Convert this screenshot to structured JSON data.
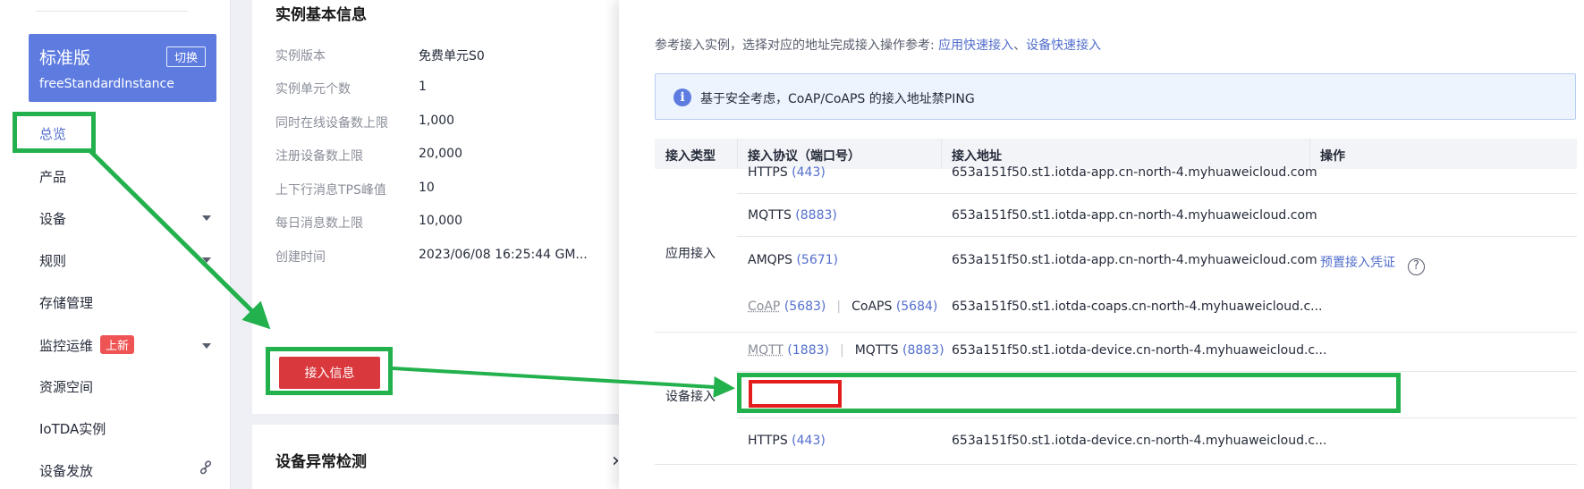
{
  "sidebar": {
    "edition": {
      "title": "标准版",
      "switch_label": "切换",
      "instance": "freeStandardInstance"
    },
    "items": [
      {
        "label": "总览",
        "active": true
      },
      {
        "label": "产品"
      },
      {
        "label": "设备",
        "expandable": true
      },
      {
        "label": "规则",
        "expandable": true
      },
      {
        "label": "存储管理"
      },
      {
        "label": "监控运维",
        "badge": "上新",
        "expandable": true
      },
      {
        "label": "资源空间"
      },
      {
        "label": "IoTDA实例"
      },
      {
        "label": "设备发放",
        "icon": "link-icon"
      }
    ]
  },
  "instance_info": {
    "title": "实例基本信息",
    "rows": [
      {
        "key": "实例版本",
        "value": "免费单元S0"
      },
      {
        "key": "实例单元个数",
        "value": "1"
      },
      {
        "key": "同时在线设备数上限",
        "value": "1,000"
      },
      {
        "key": "注册设备数上限",
        "value": "20,000"
      },
      {
        "key": "上下行消息TPS峰值",
        "value": "10"
      },
      {
        "key": "每日消息数上限",
        "value": "10,000"
      },
      {
        "key": "创建时间",
        "value": "2023/06/08 16:25:44 GM..."
      }
    ],
    "access_button": "接入信息"
  },
  "anomaly_section": {
    "title": "设备异常检测"
  },
  "drawer": {
    "ref_text": "参考接入实例，选择对应的地址完成接入操作参考: ",
    "ref_link_app": "应用快速接入",
    "ref_sep": "、",
    "ref_link_device": "设备快速接入",
    "notice": "基于安全考虑，CoAP/CoAPS 的接入地址禁PING",
    "table": {
      "headers": [
        "接入类型",
        "接入协议（端口号）",
        "接入地址",
        "操作"
      ],
      "groups": [
        {
          "label": "应用接入"
        },
        {
          "label": "设备接入"
        }
      ],
      "rows": [
        {
          "p1": "HTTPS",
          "port1": "(443)",
          "address": "653a151f50.st1.iotda-app.cn-north-4.myhuaweicloud.com"
        },
        {
          "p1": "MQTTS",
          "port1": "(8883)",
          "address": "653a151f50.st1.iotda-app.cn-north-4.myhuaweicloud.com"
        },
        {
          "p1": "AMQPS",
          "port1": "(5671)",
          "address": "653a151f50.st1.iotda-app.cn-north-4.myhuaweicloud.com",
          "action": "预置接入凭证"
        },
        {
          "p1": "CoAP",
          "port1": "(5683)",
          "p2": "CoAPS",
          "port2": "(5684)",
          "address": "653a151f50.st1.iotda-coaps.cn-north-4.myhuaweicloud.c..."
        },
        {
          "p1": "MQTT",
          "port1": "(1883)",
          "p2": "MQTTS",
          "port2": "(8883)",
          "address": "653a151f50.st1.iotda-device.cn-north-4.myhuaweicloud.c..."
        },
        {
          "p1": "HTTPS",
          "port1": "(443)",
          "address": "653a151f50.st1.iotda-device.cn-north-4.myhuaweicloud.c..."
        }
      ]
    }
  },
  "colors": {
    "accent": "#5e7ce0",
    "danger": "#d9383c",
    "annotation_green": "#22b14c",
    "annotation_red": "#e31c1c"
  }
}
